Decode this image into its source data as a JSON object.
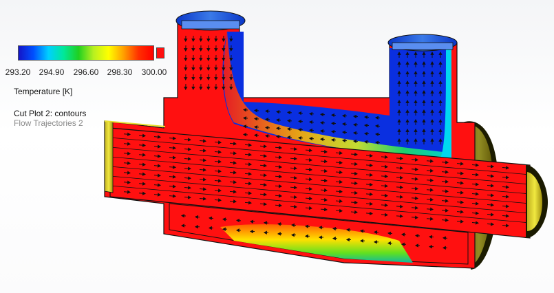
{
  "legend": {
    "gradient_colors": [
      "#1414c8",
      "#0050ff",
      "#00d0ff",
      "#00e89a",
      "#20d020",
      "#b8f020",
      "#ffff00",
      "#ffa000",
      "#ff3000",
      "#ff0000"
    ],
    "max_swatch_color": "#ff1010",
    "ticks": [
      "293.20",
      "294.90",
      "296.60",
      "298.30",
      "300.00"
    ],
    "quantity_label": "Temperature [K]",
    "cut_plot_label": "Cut Plot 2: contours",
    "trajectories_label": "Flow Trajectories 2"
  },
  "colors": {
    "hot": "#ff1010",
    "cold": "#0a2fe0",
    "steel_rim": "#2a6bd6",
    "outer_yellow": "#e8e030",
    "outer_dark": "#1a1a00",
    "arrow": "#111111"
  }
}
